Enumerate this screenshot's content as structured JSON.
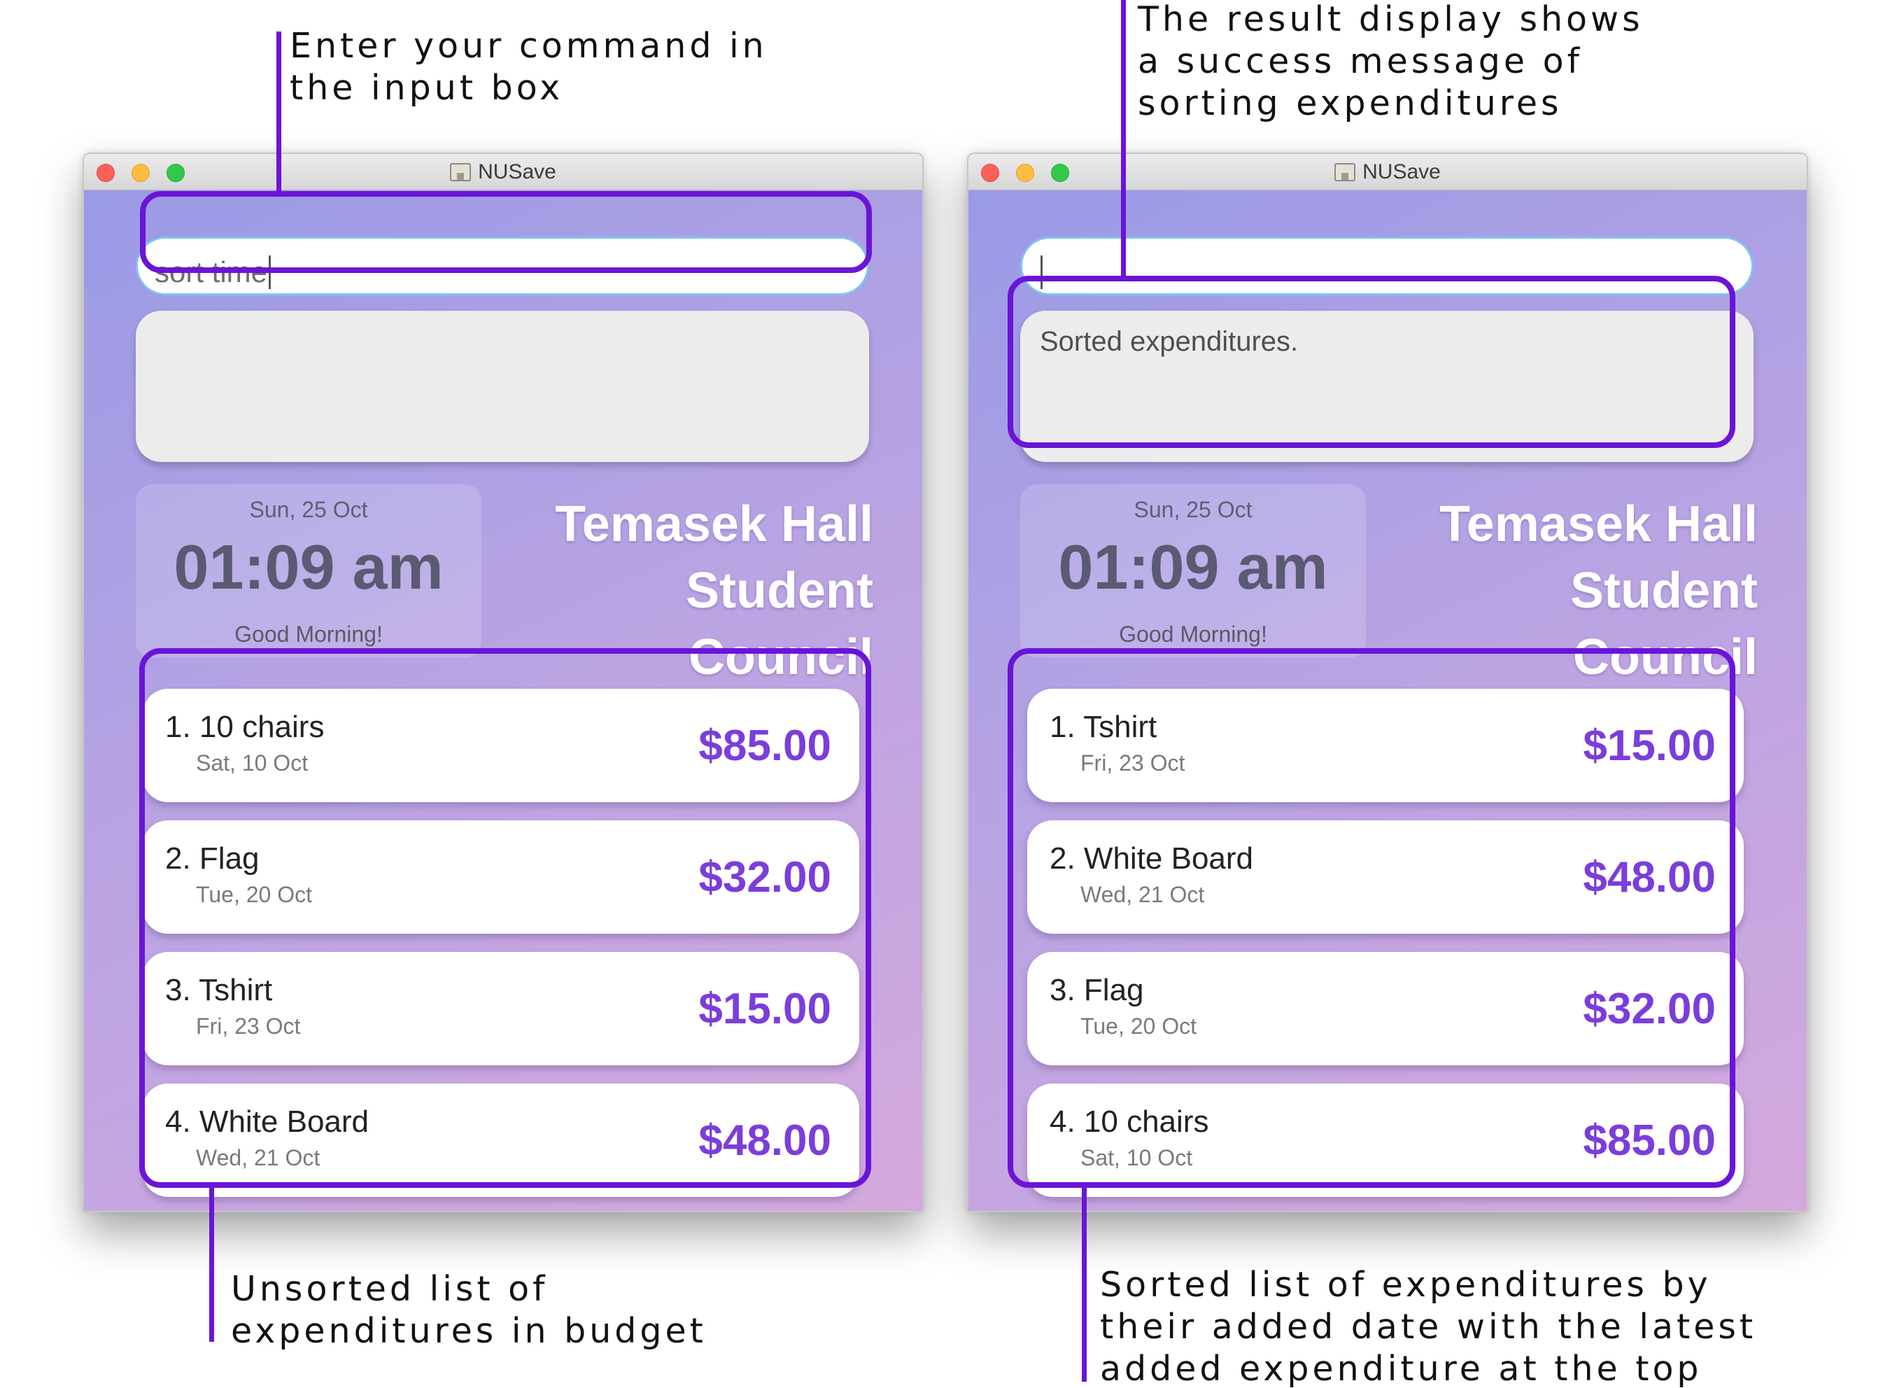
{
  "app_title": "NUSave",
  "colors": {
    "highlight": "#6b14d8",
    "amount": "#7b3ddb",
    "input_border": "#7fc4f2"
  },
  "captions": {
    "top_left": [
      "Enter your command in",
      "the input box"
    ],
    "top_right": [
      "The result display shows",
      "a success message of",
      "sorting expenditures"
    ],
    "bottom_left": [
      "Unsorted list of",
      "expenditures in budget"
    ],
    "bottom_right": [
      "Sorted list of expenditures by",
      "their added date with the latest",
      "added expenditure at the top"
    ]
  },
  "left": {
    "command_value": "sort time",
    "result_text": "",
    "clock": {
      "date": "Sun, 25 Oct",
      "time": "01:09 am",
      "greeting": "Good Morning!"
    },
    "org_name": [
      "Temasek Hall",
      "Student Council"
    ],
    "expenditures": [
      {
        "title": "1. 10 chairs",
        "date": "Sat, 10 Oct",
        "amount": "$85.00"
      },
      {
        "title": "2. Flag",
        "date": "Tue, 20 Oct",
        "amount": "$32.00"
      },
      {
        "title": "3. Tshirt",
        "date": "Fri, 23 Oct",
        "amount": "$15.00"
      },
      {
        "title": "4. White Board",
        "date": "Wed, 21 Oct",
        "amount": "$48.00"
      }
    ]
  },
  "right": {
    "command_value": "",
    "result_text": "Sorted expenditures.",
    "clock": {
      "date": "Sun, 25 Oct",
      "time": "01:09 am",
      "greeting": "Good Morning!"
    },
    "org_name": [
      "Temasek Hall",
      "Student Council"
    ],
    "expenditures": [
      {
        "title": "1. Tshirt",
        "date": "Fri, 23 Oct",
        "amount": "$15.00"
      },
      {
        "title": "2. White Board",
        "date": "Wed, 21 Oct",
        "amount": "$48.00"
      },
      {
        "title": "3. Flag",
        "date": "Tue, 20 Oct",
        "amount": "$32.00"
      },
      {
        "title": "4. 10 chairs",
        "date": "Sat, 10 Oct",
        "amount": "$85.00"
      }
    ]
  }
}
